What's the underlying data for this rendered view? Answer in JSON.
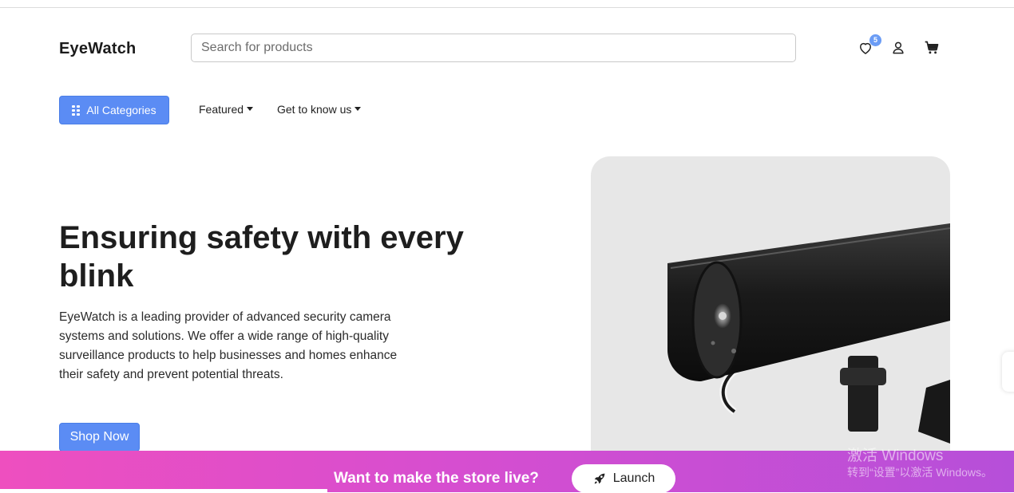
{
  "header": {
    "brand": "EyeWatch",
    "search_placeholder": "Search for products",
    "wishlist_count": "5"
  },
  "nav": {
    "all_categories": "All Categories",
    "featured": "Featured",
    "get_to_know_us": "Get to know us"
  },
  "hero": {
    "title": "Ensuring safety with every blink",
    "description": "EyeWatch is a leading provider of advanced security camera systems and solutions. We offer a wide range of high-quality surveillance products to help businesses and homes enhance their safety and prevent potential threats.",
    "cta": "Shop Now"
  },
  "banner": {
    "text": "Want to make the store live?",
    "button": "Launch"
  },
  "watermark": {
    "title": "激活 Windows",
    "subtitle": "转到“设置”以激活 Windows。"
  },
  "colors": {
    "accent": "#5b8cf4",
    "banner_start": "#ee4fbf",
    "banner_end": "#b64fd9"
  },
  "icons": [
    "heart-icon",
    "user-icon",
    "cart-icon",
    "grid-icon",
    "rocket-icon"
  ]
}
